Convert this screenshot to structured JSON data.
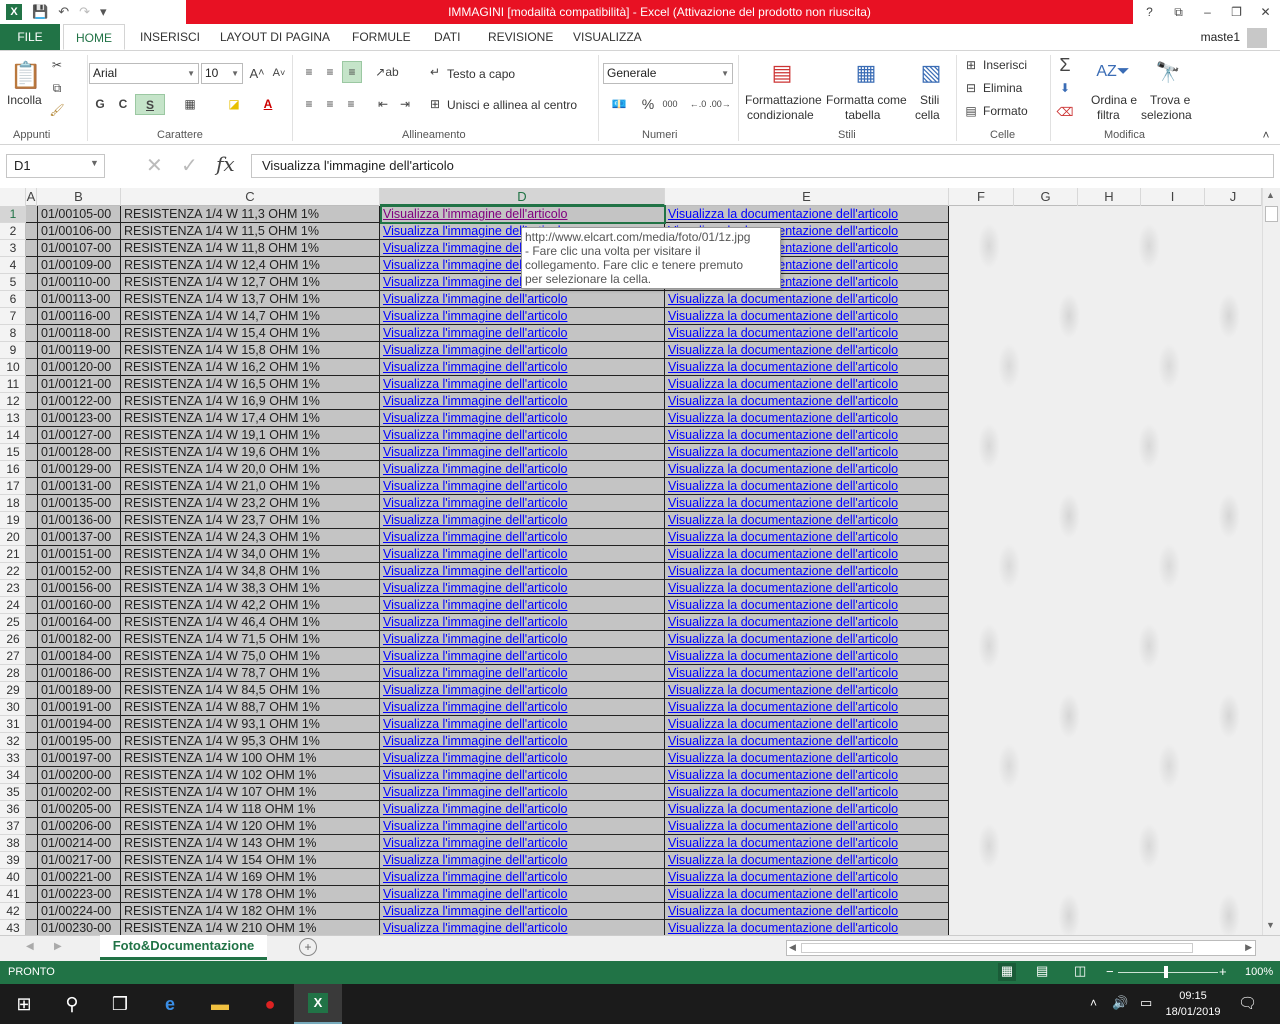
{
  "window": {
    "title": "IMMAGINI  [modalità compatibilità] -  Excel (Attivazione del prodotto non riuscita)",
    "user": "maste1",
    "controls": [
      "?",
      "⧉",
      "–",
      "❐",
      "✕"
    ]
  },
  "ribbon_tabs": [
    "FILE",
    "HOME",
    "INSERISCI",
    "LAYOUT DI PAGINA",
    "FORMULE",
    "DATI",
    "REVISIONE",
    "VISUALIZZA"
  ],
  "ribbon": {
    "clipboard": {
      "paste": "Incolla",
      "group": "Appunti"
    },
    "font": {
      "name": "Arial",
      "size": "10",
      "bold": "G",
      "italic": "C",
      "underline": "S",
      "group": "Carattere"
    },
    "alignment": {
      "wrap": "Testo a capo",
      "merge": "Unisci e allinea al centro",
      "group": "Allineamento"
    },
    "number": {
      "format": "Generale",
      "percent": "%",
      "thousands": "000",
      "group": "Numeri"
    },
    "styles": {
      "conditional_1": "Formattazione",
      "conditional_2": "condizionale",
      "table_1": "Formatta come",
      "table_2": "tabella",
      "cell_1": "Stili",
      "cell_2": "cella",
      "group": "Stili"
    },
    "cells": {
      "insert": "Inserisci",
      "delete": "Elimina",
      "format": "Formato",
      "group": "Celle"
    },
    "editing": {
      "sort_1": "Ordina e",
      "sort_2": "filtra",
      "find_1": "Trova e",
      "find_2": "seleziona",
      "group": "Modifica"
    }
  },
  "formula_bar": {
    "name_box": "D1",
    "content": "Visualizza l'immagine dell'articolo"
  },
  "columns": [
    "A",
    "B",
    "C",
    "D",
    "E",
    "F",
    "G",
    "H",
    "I",
    "J"
  ],
  "link_texts": {
    "image": "Visualizza l'immagine dell'articolo",
    "doc": "Visualizza la documentazione dell'articolo"
  },
  "rows": [
    {
      "n": "1",
      "code": "01/00105-00",
      "desc": "RESISTENZA 1/4 W  11,3   OHM  1%"
    },
    {
      "n": "2",
      "code": "01/00106-00",
      "desc": "RESISTENZA 1/4 W  11,5   OHM  1%"
    },
    {
      "n": "3",
      "code": "01/00107-00",
      "desc": "RESISTENZA 1/4 W  11,8   OHM  1%"
    },
    {
      "n": "4",
      "code": "01/00109-00",
      "desc": "RESISTENZA 1/4 W  12,4   OHM  1%"
    },
    {
      "n": "5",
      "code": "01/00110-00",
      "desc": "RESISTENZA 1/4 W  12,7   OHM  1%"
    },
    {
      "n": "6",
      "code": "01/00113-00",
      "desc": "RESISTENZA 1/4 W  13,7   OHM  1%"
    },
    {
      "n": "7",
      "code": "01/00116-00",
      "desc": "RESISTENZA 1/4 W  14,7   OHM  1%"
    },
    {
      "n": "8",
      "code": "01/00118-00",
      "desc": "RESISTENZA 1/4 W  15,4   OHM  1%"
    },
    {
      "n": "9",
      "code": "01/00119-00",
      "desc": "RESISTENZA 1/4 W  15,8   OHM  1%"
    },
    {
      "n": "10",
      "code": "01/00120-00",
      "desc": "RESISTENZA 1/4 W  16,2   OHM  1%"
    },
    {
      "n": "11",
      "code": "01/00121-00",
      "desc": "RESISTENZA 1/4 W  16,5   OHM  1%"
    },
    {
      "n": "12",
      "code": "01/00122-00",
      "desc": "RESISTENZA 1/4 W  16,9   OHM  1%"
    },
    {
      "n": "13",
      "code": "01/00123-00",
      "desc": "RESISTENZA 1/4 W  17,4   OHM  1%"
    },
    {
      "n": "14",
      "code": "01/00127-00",
      "desc": "RESISTENZA 1/4 W  19,1   OHM  1%"
    },
    {
      "n": "15",
      "code": "01/00128-00",
      "desc": "RESISTENZA 1/4 W  19,6   OHM  1%"
    },
    {
      "n": "16",
      "code": "01/00129-00",
      "desc": "RESISTENZA 1/4 W  20,0   OHM  1%"
    },
    {
      "n": "17",
      "code": "01/00131-00",
      "desc": "RESISTENZA 1/4 W  21,0   OHM  1%"
    },
    {
      "n": "18",
      "code": "01/00135-00",
      "desc": "RESISTENZA 1/4 W  23,2   OHM  1%"
    },
    {
      "n": "19",
      "code": "01/00136-00",
      "desc": "RESISTENZA 1/4 W  23,7   OHM  1%"
    },
    {
      "n": "20",
      "code": "01/00137-00",
      "desc": "RESISTENZA 1/4 W  24,3   OHM  1%"
    },
    {
      "n": "21",
      "code": "01/00151-00",
      "desc": "RESISTENZA 1/4 W  34,0   OHM  1%"
    },
    {
      "n": "22",
      "code": "01/00152-00",
      "desc": "RESISTENZA 1/4 W  34,8   OHM  1%"
    },
    {
      "n": "23",
      "code": "01/00156-00",
      "desc": "RESISTENZA 1/4 W  38,3   OHM  1%"
    },
    {
      "n": "24",
      "code": "01/00160-00",
      "desc": "RESISTENZA 1/4 W  42,2   OHM  1%"
    },
    {
      "n": "25",
      "code": "01/00164-00",
      "desc": "RESISTENZA 1/4 W  46,4   OHM  1%"
    },
    {
      "n": "26",
      "code": "01/00182-00",
      "desc": "RESISTENZA 1/4 W  71,5   OHM  1%"
    },
    {
      "n": "27",
      "code": "01/00184-00",
      "desc": "RESISTENZA 1/4 W  75,0   OHM  1%"
    },
    {
      "n": "28",
      "code": "01/00186-00",
      "desc": "RESISTENZA 1/4 W  78,7   OHM  1%"
    },
    {
      "n": "29",
      "code": "01/00189-00",
      "desc": "RESISTENZA 1/4 W  84,5   OHM  1%"
    },
    {
      "n": "30",
      "code": "01/00191-00",
      "desc": "RESISTENZA 1/4 W  88,7   OHM  1%"
    },
    {
      "n": "31",
      "code": "01/00194-00",
      "desc": "RESISTENZA 1/4 W  93,1   OHM  1%"
    },
    {
      "n": "32",
      "code": "01/00195-00",
      "desc": "RESISTENZA 1/4 W  95,3   OHM  1%"
    },
    {
      "n": "33",
      "code": "01/00197-00",
      "desc": "RESISTENZA 1/4 W 100    OHM  1%"
    },
    {
      "n": "34",
      "code": "01/00200-00",
      "desc": "RESISTENZA 1/4 W 102    OHM  1%"
    },
    {
      "n": "35",
      "code": "01/00202-00",
      "desc": "RESISTENZA 1/4 W 107    OHM  1%"
    },
    {
      "n": "36",
      "code": "01/00205-00",
      "desc": "RESISTENZA 1/4 W 118    OHM  1%"
    },
    {
      "n": "37",
      "code": "01/00206-00",
      "desc": "RESISTENZA 1/4 W   120  OHM  1%"
    },
    {
      "n": "38",
      "code": "01/00214-00",
      "desc": "RESISTENZA 1/4 W 143    OHM  1%"
    },
    {
      "n": "39",
      "code": "01/00217-00",
      "desc": "RESISTENZA 1/4 W 154    OHM  1%"
    },
    {
      "n": "40",
      "code": "01/00221-00",
      "desc": "RESISTENZA 1/4 W 169    OHM  1%"
    },
    {
      "n": "41",
      "code": "01/00223-00",
      "desc": "RESISTENZA 1/4 W 178    OHM  1%"
    },
    {
      "n": "42",
      "code": "01/00224-00",
      "desc": "RESISTENZA 1/4 W 182    OHM  1%"
    },
    {
      "n": "43",
      "code": "01/00230-00",
      "desc": "RESISTENZA 1/4 W 210    OHM  1%"
    }
  ],
  "tooltip": {
    "url": "http://www.elcart.com/media/foto/01/1z.jpg",
    "line2": "- Fare clic una volta per visitare il",
    "line3": "collegamento. Fare clic e tenere premuto",
    "line4": "per selezionare la cella."
  },
  "sheet_tab": "Foto&Documentazione",
  "status": {
    "ready": "PRONTO",
    "zoom": "100%"
  },
  "taskbar": {
    "time": "09:15",
    "date": "18/01/2019"
  },
  "colors": {
    "excel_green": "#217346",
    "title_red": "#e81123",
    "link": "#0000ff",
    "visited": "#800080",
    "cell_fill": "#c4c4c4"
  }
}
